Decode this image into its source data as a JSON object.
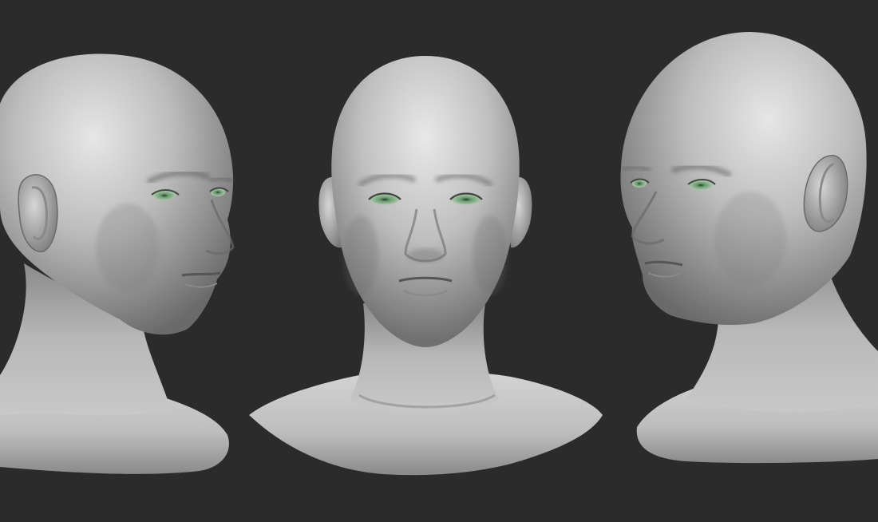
{
  "viewport": {
    "background": "#2b2b2b",
    "views": [
      {
        "name": "three-quarter-left",
        "eye_color": "#6a9a6e"
      },
      {
        "name": "front",
        "eye_color": "#6a9a6e"
      },
      {
        "name": "three-quarter-right",
        "eye_color": "#6a9a6e"
      }
    ]
  },
  "colors": {
    "skin_highlight": "#e6e6e6",
    "skin_mid": "#b4b4b4",
    "skin_shadow": "#5a5a5a",
    "iris": "#6a9a6e"
  }
}
